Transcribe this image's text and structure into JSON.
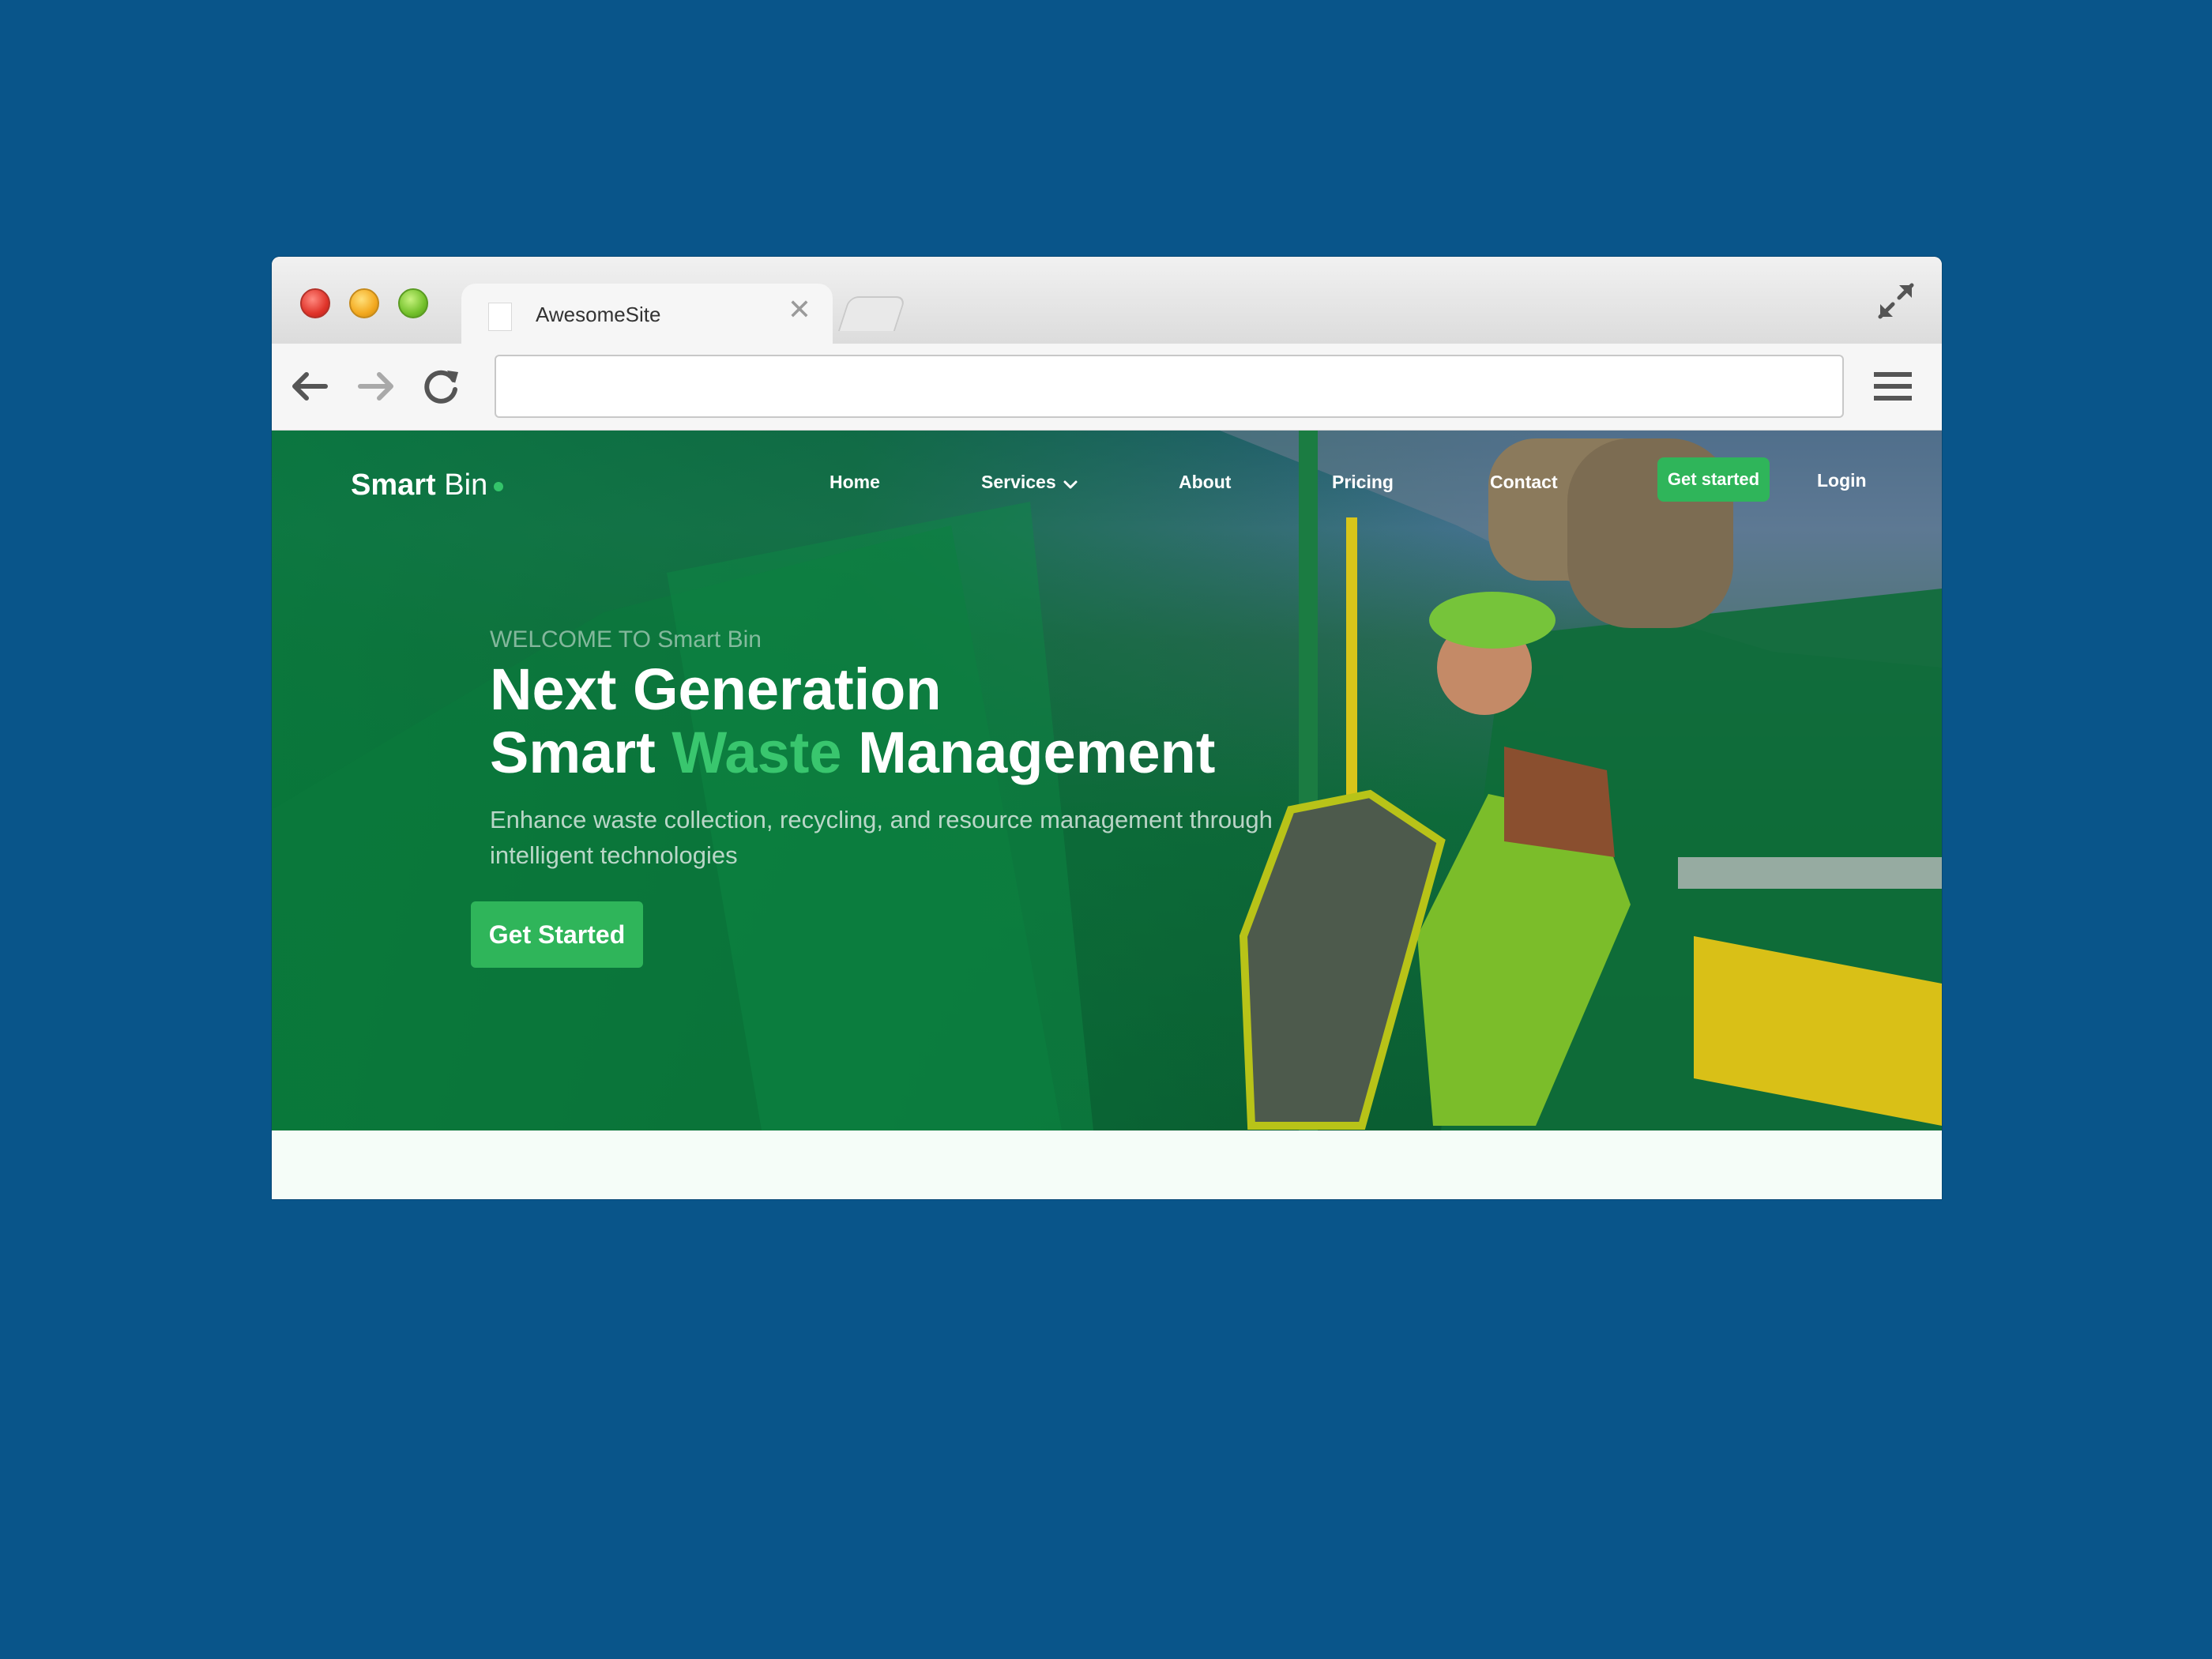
{
  "browser": {
    "tab_title": "AwesomeSite",
    "tab_close": "✕",
    "url": "",
    "icons": [
      "back-arrow-icon",
      "forward-arrow-icon",
      "reload-icon",
      "menu-icon",
      "expand-icon",
      "page-icon"
    ]
  },
  "site": {
    "brand_bold": "Smart",
    "brand_rest": " Bin",
    "nav": {
      "home": "Home",
      "services": "Services",
      "about": "About",
      "pricing": "Pricing",
      "contact": "Contact",
      "get_started": "Get started",
      "login": "Login"
    },
    "hero": {
      "welcome": "WELCOME TO Smart Bin",
      "title_line1": "Next Generation",
      "title_line2_a": "Smart ",
      "title_line2_accent": "Waste",
      "title_line2_b": " Management",
      "subtitle": "Enhance waste collection, recycling, and resource management through intelligent technologies",
      "cta": "Get Started"
    }
  },
  "colors": {
    "page_background": "#09558a",
    "accent_green": "#2fb55a",
    "headline_accent": "#39c66e"
  }
}
